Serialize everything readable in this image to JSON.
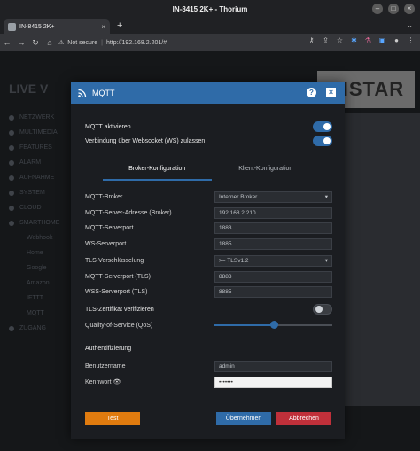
{
  "window": {
    "title": "IN-8415 2K+ - Thorium"
  },
  "tabs": [
    {
      "label": "IN-8415 2K+"
    }
  ],
  "address": {
    "security": "Not secure",
    "url": "http://192.168.2.201/#"
  },
  "background": {
    "heading": "LIVE V",
    "logo": "INSTAR",
    "sidebar": [
      "NETZWERK",
      "MULTIMEDIA",
      "FEATURES",
      "ALARM",
      "AUFNAHME",
      "SYSTEM",
      "CLOUD",
      "SMARTHOME",
      "Webhook",
      "Home",
      "Google",
      "Amazon",
      "IFTTT",
      "MQTT",
      "ZUGANG"
    ]
  },
  "modal": {
    "title": "MQTT",
    "toggles": [
      {
        "label": "MQTT aktivieren",
        "on": true
      },
      {
        "label": "Verbindung über Websocket (WS) zulassen",
        "on": true
      }
    ],
    "tabs": [
      {
        "label": "Broker-Konfiguration",
        "active": true
      },
      {
        "label": "Klient-Konfiguration",
        "active": false
      }
    ],
    "fields": [
      {
        "label": "MQTT-Broker",
        "value": "Interner Broker",
        "type": "select"
      },
      {
        "label": "MQTT-Server-Adresse (Broker)",
        "value": "192.168.2.210",
        "type": "text"
      },
      {
        "label": "MQTT-Serverport",
        "value": "1883",
        "type": "text"
      },
      {
        "label": "WS-Serverport",
        "value": "1885",
        "type": "text"
      },
      {
        "label": "TLS-Verschlüsselung",
        "value": ">= TLSv1.2",
        "type": "select"
      },
      {
        "label": "MQTT-Serverport (TLS)",
        "value": "8883",
        "type": "text"
      },
      {
        "label": "WSS-Serverport (TLS)",
        "value": "8885",
        "type": "text"
      }
    ],
    "tls_verify": {
      "label": "TLS-Zertifikat verifizieren",
      "on": false
    },
    "qos": {
      "label": "Quality-of-Service (QoS)",
      "value": 0.5
    },
    "auth": {
      "section": "Authentifizierung",
      "username_label": "Benutzername",
      "username_value": "admin",
      "password_label": "Kennwort",
      "password_value": "•••••••"
    },
    "buttons": {
      "test": "Test",
      "ok": "Übernehmen",
      "cancel": "Abbrechen"
    },
    "colors": {
      "accent": "#2f6ba8",
      "test": "#e07b0f",
      "cancel": "#c0303a"
    }
  }
}
